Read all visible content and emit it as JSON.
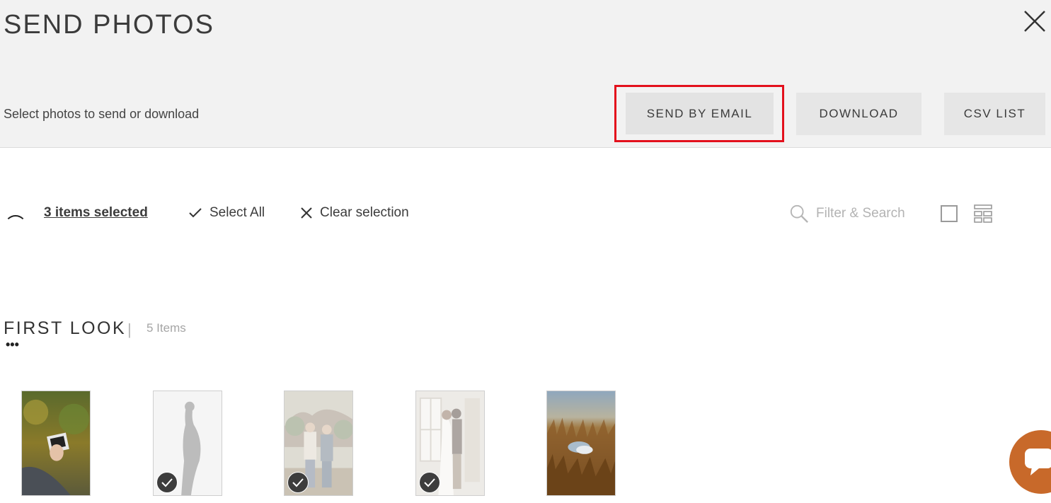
{
  "header": {
    "title": "SEND PHOTOS",
    "subtitle": "Select photos to send or download",
    "buttons": {
      "send_by_email": "SEND BY EMAIL",
      "download": "DOWNLOAD",
      "csv_list": "CSV LIST"
    },
    "highlight_color": "#e3101c"
  },
  "toolbar": {
    "selected_count": "3 items selected",
    "select_all": "Select All",
    "clear_selection": "Clear selection",
    "search_placeholder": "Filter & Search"
  },
  "section": {
    "title": "FIRST LOOK",
    "separator": "|",
    "count": "5 Items",
    "menu": "•••"
  },
  "thumbnails": [
    {
      "name": "ultrasound-photo",
      "selected": false
    },
    {
      "name": "maternity-silhouette-photo",
      "selected": true
    },
    {
      "name": "couple-outdoor-photo",
      "selected": true
    },
    {
      "name": "couple-window-photo",
      "selected": true
    },
    {
      "name": "baby-shoes-wheat-photo",
      "selected": false
    }
  ],
  "icons": {
    "close": "close-icon",
    "check": "checkmark-icon",
    "clear": "x-icon",
    "search": "search-icon",
    "chat": "chat-icon"
  },
  "colors": {
    "header_bg": "#f2f2f2",
    "button_bg": "#e6e6e6",
    "chat_bubble": "#c8692a"
  }
}
